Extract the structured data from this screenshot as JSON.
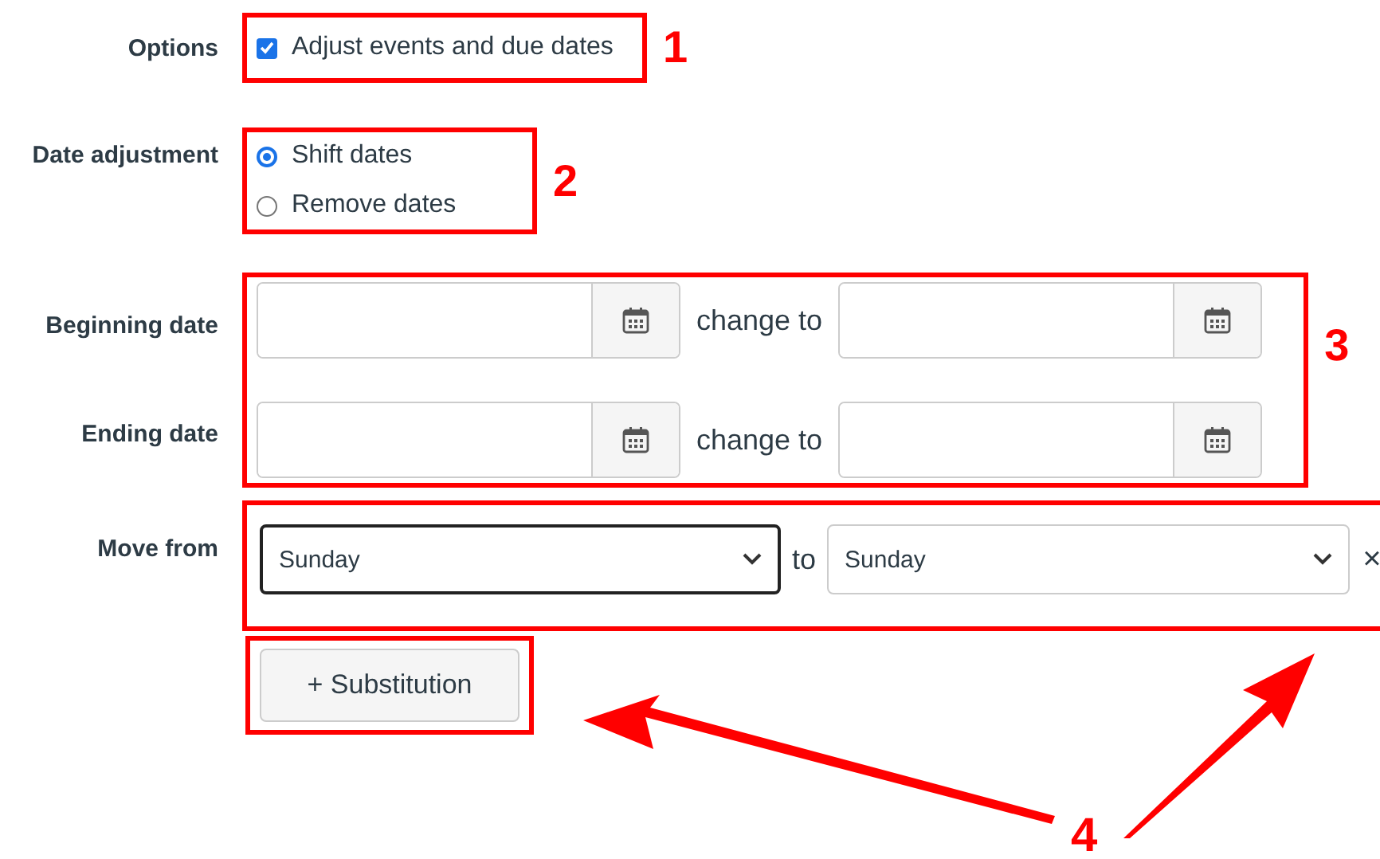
{
  "options": {
    "label": "Options",
    "checkbox": {
      "label": "Adjust events and due dates",
      "checked": true
    },
    "callout": "1"
  },
  "date_adjustment": {
    "label": "Date adjustment",
    "radios": [
      {
        "label": "Shift dates",
        "selected": true
      },
      {
        "label": "Remove dates",
        "selected": false
      }
    ],
    "callout": "2"
  },
  "date_ranges": {
    "rows": [
      {
        "label": "Beginning date",
        "connector": "change to"
      },
      {
        "label": "Ending date",
        "connector": "change to"
      }
    ],
    "callout": "3"
  },
  "move_from": {
    "label": "Move from",
    "from": "Sunday",
    "connector": "to",
    "to": "Sunday",
    "remove": "×"
  },
  "add_button": {
    "label": "+ Substitution"
  },
  "arrows_callout": "4"
}
